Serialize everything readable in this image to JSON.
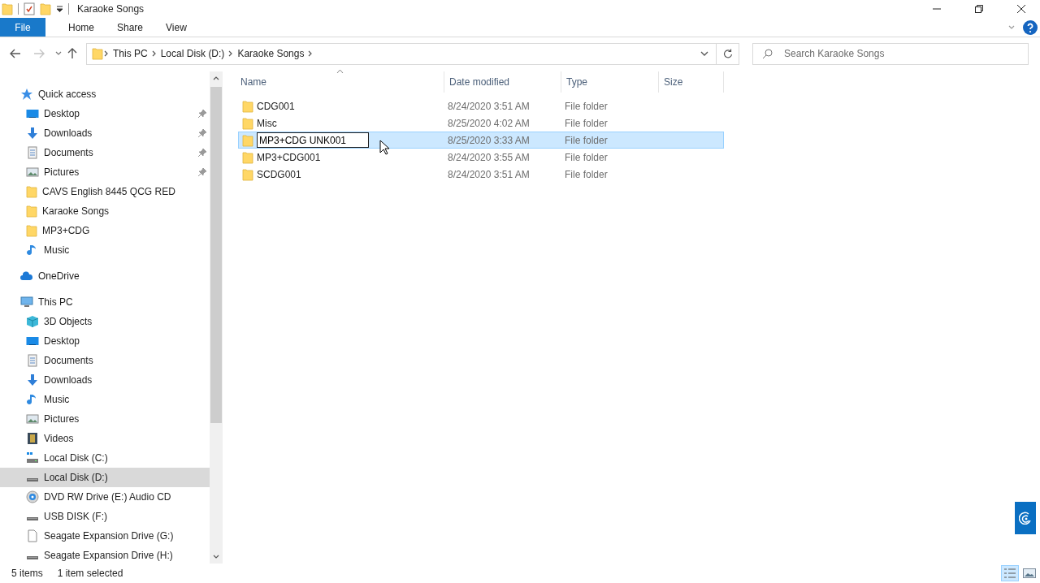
{
  "window": {
    "title": "Karaoke Songs"
  },
  "ribbon": {
    "tabs": [
      {
        "label": "File",
        "kind": "file"
      },
      {
        "label": "Home",
        "kind": "tab"
      },
      {
        "label": "Share",
        "kind": "tab"
      },
      {
        "label": "View",
        "kind": "tab"
      }
    ]
  },
  "address": {
    "crumbs": [
      "This PC",
      "Local Disk (D:)",
      "Karaoke Songs"
    ]
  },
  "search": {
    "placeholder": "Search Karaoke Songs"
  },
  "sidebar": {
    "items": [
      {
        "label": "Quick access",
        "kind": "star",
        "selected": false,
        "children": [
          {
            "label": "Desktop",
            "kind": "desktop",
            "pinned": true,
            "selected": false
          },
          {
            "label": "Downloads",
            "kind": "downloads",
            "pinned": true,
            "selected": false
          },
          {
            "label": "Documents",
            "kind": "documents",
            "pinned": true,
            "selected": false
          },
          {
            "label": "Pictures",
            "kind": "pictures",
            "pinned": true,
            "selected": false
          },
          {
            "label": "CAVS English 8445 QCG RED",
            "kind": "folder",
            "pinned": false,
            "selected": false
          },
          {
            "label": "Karaoke Songs",
            "kind": "folder",
            "pinned": false,
            "selected": false
          },
          {
            "label": "MP3+CDG",
            "kind": "folder",
            "pinned": false,
            "selected": false
          },
          {
            "label": "Music",
            "kind": "music",
            "pinned": false,
            "selected": false
          }
        ]
      },
      {
        "label": "OneDrive",
        "kind": "cloud",
        "selected": false
      },
      {
        "label": "This PC",
        "kind": "pc",
        "selected": false,
        "children": [
          {
            "label": "3D Objects",
            "kind": "objects",
            "selected": false
          },
          {
            "label": "Desktop",
            "kind": "desktop",
            "selected": false
          },
          {
            "label": "Documents",
            "kind": "documents",
            "selected": false
          },
          {
            "label": "Downloads",
            "kind": "downloads",
            "selected": false
          },
          {
            "label": "Music",
            "kind": "music",
            "selected": false
          },
          {
            "label": "Pictures",
            "kind": "pictures",
            "selected": false
          },
          {
            "label": "Videos",
            "kind": "videos",
            "selected": false
          },
          {
            "label": "Local Disk (C:)",
            "kind": "windrive",
            "selected": false
          },
          {
            "label": "Local Disk (D:)",
            "kind": "drive",
            "selected": true
          },
          {
            "label": "DVD RW Drive (E:) Audio CD",
            "kind": "dvd",
            "selected": false
          },
          {
            "label": "USB DISK (F:)",
            "kind": "drive",
            "selected": false
          },
          {
            "label": "Seagate Expansion Drive (G:)",
            "kind": "blank",
            "selected": false
          },
          {
            "label": "Seagate Expansion Drive (H:)",
            "kind": "drive",
            "selected": false
          }
        ]
      }
    ]
  },
  "table": {
    "columns": [
      {
        "label": "Name",
        "sorted": true
      },
      {
        "label": "Date modified",
        "sorted": false
      },
      {
        "label": "Type",
        "sorted": false
      },
      {
        "label": "Size",
        "sorted": false
      }
    ],
    "rows": [
      {
        "name": "CDG001",
        "date": "8/24/2020 3:51 AM",
        "type": "File folder",
        "selected": false,
        "editing": false
      },
      {
        "name": "Misc",
        "date": "8/25/2020 4:02 AM",
        "type": "File folder",
        "selected": false,
        "editing": false
      },
      {
        "name": "MP3+CDG UNK001",
        "date": "8/25/2020 3:33 AM",
        "type": "File folder",
        "selected": true,
        "editing": true
      },
      {
        "name": "MP3+CDG001",
        "date": "8/24/2020 3:55 AM",
        "type": "File folder",
        "selected": false,
        "editing": false
      },
      {
        "name": "SCDG001",
        "date": "8/24/2020 3:51 AM",
        "type": "File folder",
        "selected": false,
        "editing": false
      }
    ]
  },
  "status_bar": {
    "item_count": "5 items",
    "selection": "1 item selected"
  },
  "view_buttons": [
    {
      "kind": "details",
      "selected": true
    },
    {
      "kind": "thumbnails",
      "selected": false
    }
  ]
}
